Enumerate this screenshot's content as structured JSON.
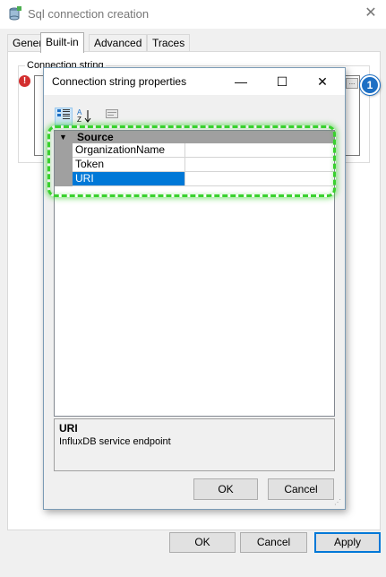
{
  "window": {
    "title": "Sql connection creation",
    "close_label": "✕"
  },
  "tabs": [
    {
      "label": "General"
    },
    {
      "label": "Built-in"
    },
    {
      "label": "Advanced"
    },
    {
      "label": "Traces"
    }
  ],
  "active_tab": "Built-in",
  "connection_group": {
    "label": "Connection string",
    "ellipsis_label": "...",
    "callout_number": "1"
  },
  "dialog": {
    "title": "Connection string properties",
    "controls": {
      "minimize": "—",
      "maximize": "☐",
      "close": "✕"
    },
    "toolbar": {
      "categorized_icon": "categorized-view-icon",
      "alphabetical_icon": "alphabetical-sort-icon",
      "property_pages_icon": "property-pages-icon"
    },
    "grid": {
      "category": "Source",
      "properties": [
        {
          "name": "OrganizationName",
          "value": ""
        },
        {
          "name": "Token",
          "value": ""
        },
        {
          "name": "URI",
          "value": ""
        }
      ],
      "selected": "URI"
    },
    "description": {
      "title": "URI",
      "text": "InfluxDB service endpoint"
    },
    "buttons": {
      "ok": "OK",
      "cancel": "Cancel"
    }
  },
  "buttons": {
    "ok": "OK",
    "cancel": "Cancel",
    "apply": "Apply"
  },
  "colors": {
    "accent": "#0078d7",
    "highlight": "#39d12e",
    "badge": "#1d6fc4",
    "error": "#d32f2f"
  }
}
